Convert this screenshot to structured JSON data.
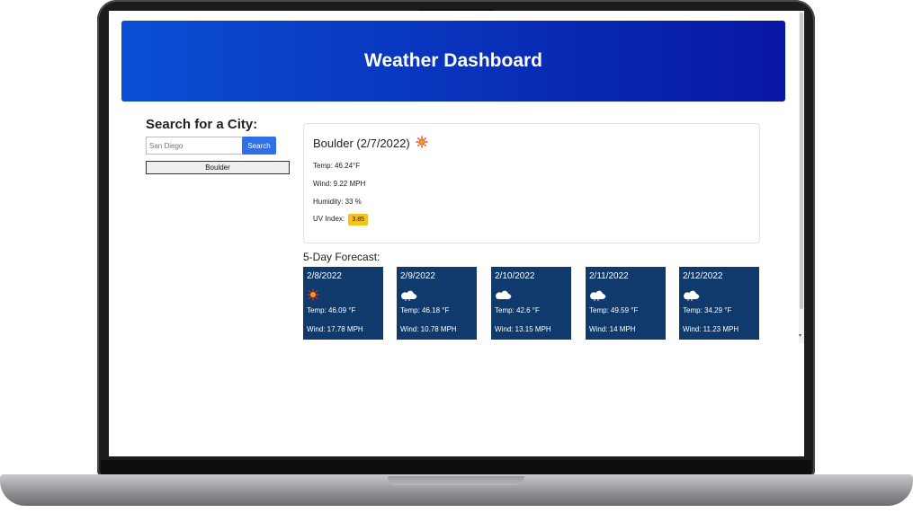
{
  "header": {
    "title": "Weather Dashboard"
  },
  "search": {
    "title": "Search for a City:",
    "placeholder": "San Diego",
    "button_label": "Search",
    "history": [
      "Boulder"
    ]
  },
  "current": {
    "title": "Boulder (2/7/2022)",
    "icon": "sun-icon",
    "temp": "Temp: 46.24°F",
    "wind": "Wind: 9.22 MPH",
    "humidity": "Humidity: 33 %",
    "uv_label": "UV Index:",
    "uv_value": "3.85",
    "uv_color": "#f4c21a"
  },
  "forecast": {
    "title": "5-Day Forecast:",
    "days": [
      {
        "date": "2/8/2022",
        "icon": "sun-icon",
        "temp": "Temp: 46.09 °F",
        "wind": "Wind: 17.78 MPH"
      },
      {
        "date": "2/9/2022",
        "icon": "partly-cloudy-night-icon",
        "temp": "Temp: 46.18 °F",
        "wind": "Wind: 10.78 MPH"
      },
      {
        "date": "2/10/2022",
        "icon": "partly-cloudy-night-icon",
        "temp": "Temp: 42.6 °F",
        "wind": "Wind: 13.15 MPH"
      },
      {
        "date": "2/11/2022",
        "icon": "partly-cloudy-night-icon",
        "temp": "Temp: 49.59 °F",
        "wind": "Wind: 14 MPH"
      },
      {
        "date": "2/12/2022",
        "icon": "partly-cloudy-night-icon",
        "temp": "Temp: 34.29 °F",
        "wind": "Wind: 11.23 MPH"
      }
    ]
  },
  "colors": {
    "header_start": "#0a4fd4",
    "header_end": "#0817a3",
    "card_bg": "#0f3a6b",
    "search_button": "#2f6fe8"
  }
}
